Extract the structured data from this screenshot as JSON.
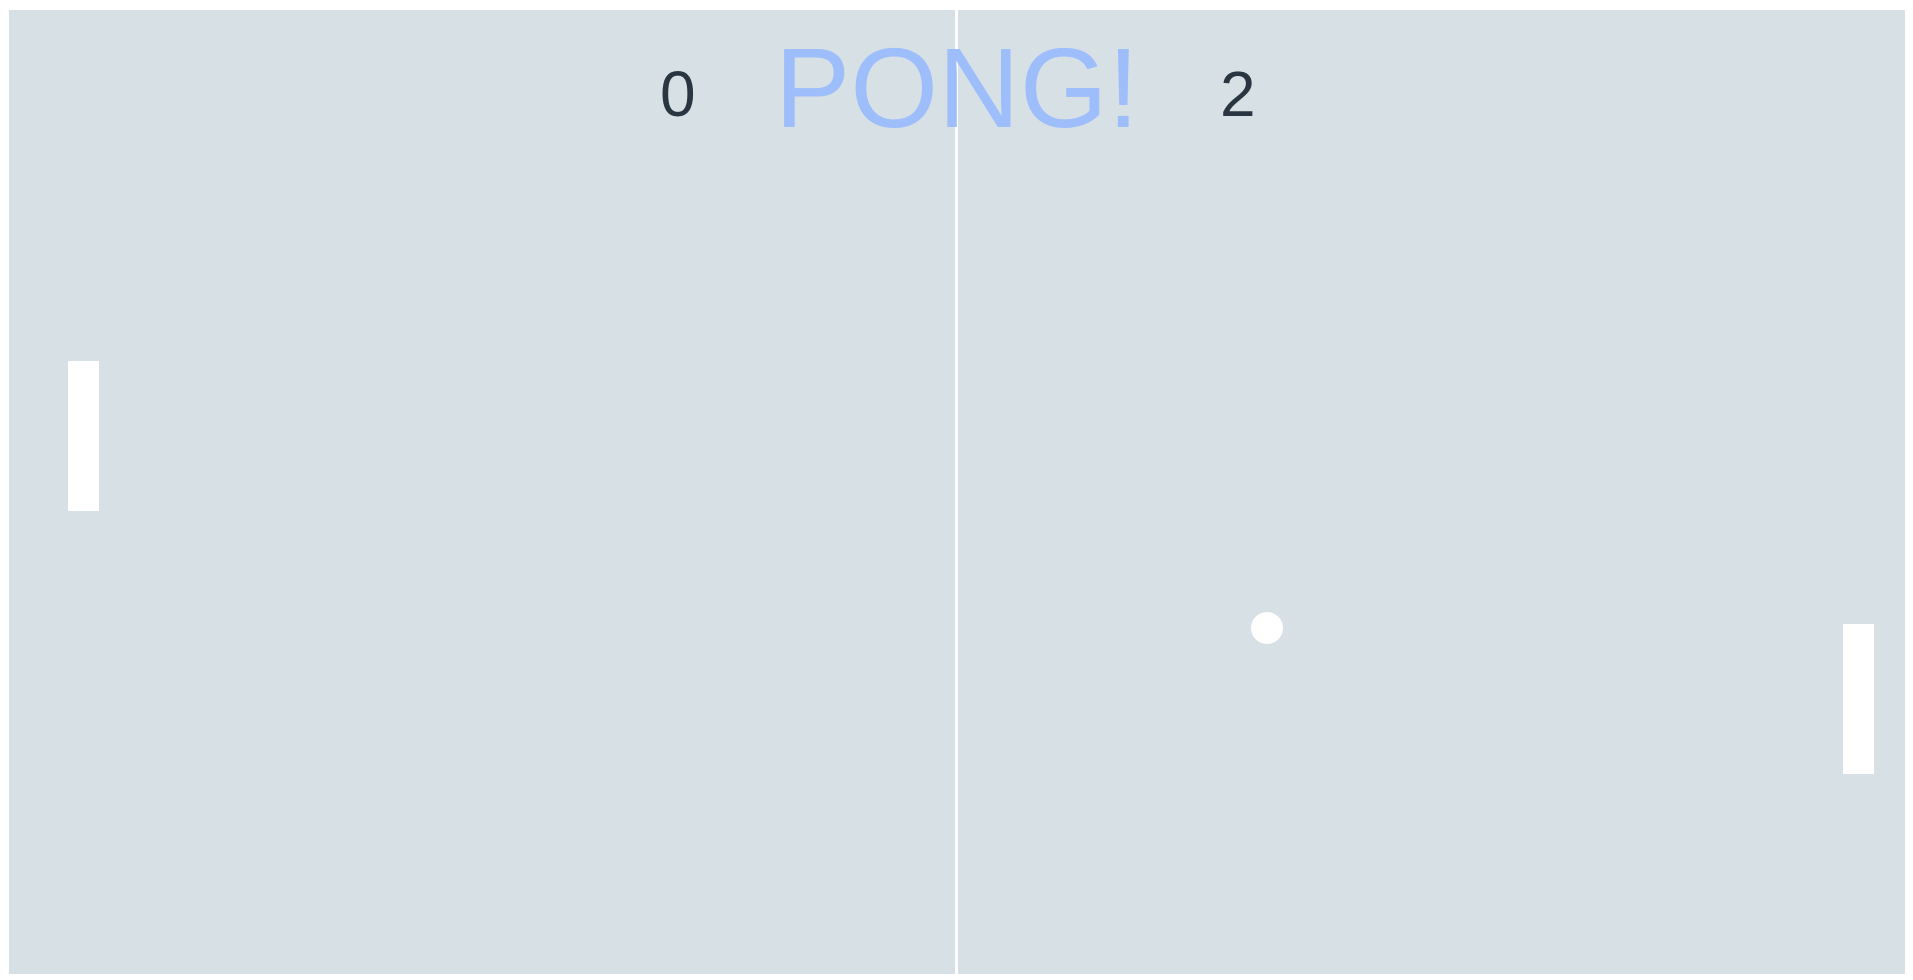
{
  "game": {
    "title": "PONG!",
    "colors": {
      "court": "#d7e0e5",
      "title": "#9dbdfb",
      "score": "#2a3542",
      "paddle": "#ffffff",
      "ball": "#ffffff",
      "net": "#ffffff"
    }
  },
  "scores": {
    "left": "0",
    "right": "2"
  }
}
